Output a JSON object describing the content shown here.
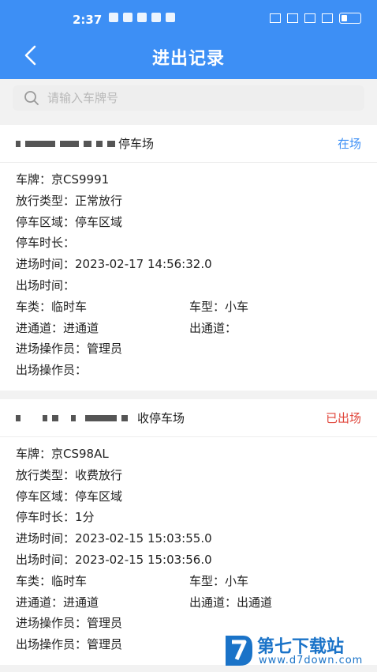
{
  "status_bar": {
    "time": "2:37"
  },
  "header": {
    "title": "进出记录"
  },
  "search": {
    "placeholder": "请输入车牌号"
  },
  "records": [
    {
      "lot_name": "停车场",
      "status": "在场",
      "status_color": "#3d8ff5",
      "fields": {
        "plate_label": "车牌：",
        "plate": "京CS9991",
        "release_type_label": "放行类型：",
        "release_type": "正常放行",
        "area_label": "停车区域：",
        "area": "停车区域",
        "duration_label": "停车时长：",
        "duration": "",
        "entry_time_label": "进场时间：",
        "entry_time": "2023-02-17 14:56:32.0",
        "exit_time_label": "出场时间：",
        "exit_time": "",
        "vehicle_class_label": "车类：",
        "vehicle_class": "临时车",
        "vehicle_type_label": "车型：",
        "vehicle_type": "小车",
        "entry_lane_label": "进通道：",
        "entry_lane": "进通道",
        "exit_lane_label": "出通道：",
        "exit_lane": "",
        "entry_operator_label": "进场操作员：",
        "entry_operator": "管理员",
        "exit_operator_label": "出场操作员：",
        "exit_operator": ""
      }
    },
    {
      "lot_name": "收停车场",
      "status": "已出场",
      "status_color": "#e0453a",
      "fields": {
        "plate_label": "车牌：",
        "plate": "京CS98AL",
        "release_type_label": "放行类型：",
        "release_type": "收费放行",
        "area_label": "停车区域：",
        "area": "停车区域",
        "duration_label": "停车时长：",
        "duration": "1分",
        "entry_time_label": "进场时间：",
        "entry_time": "2023-02-15 15:03:55.0",
        "exit_time_label": "出场时间：",
        "exit_time": "2023-02-15 15:03:56.0",
        "vehicle_class_label": "车类：",
        "vehicle_class": "临时车",
        "vehicle_type_label": "车型：",
        "vehicle_type": "小车",
        "entry_lane_label": "进通道：",
        "entry_lane": "进通道",
        "exit_lane_label": "出通道：",
        "exit_lane": "出通道",
        "entry_operator_label": "进场操作员：",
        "entry_operator": "管理员",
        "exit_operator_label": "出场操作员：",
        "exit_operator": "管理员"
      }
    }
  ],
  "watermark": {
    "name": "第七下载站",
    "url": "www.d7down.com"
  }
}
